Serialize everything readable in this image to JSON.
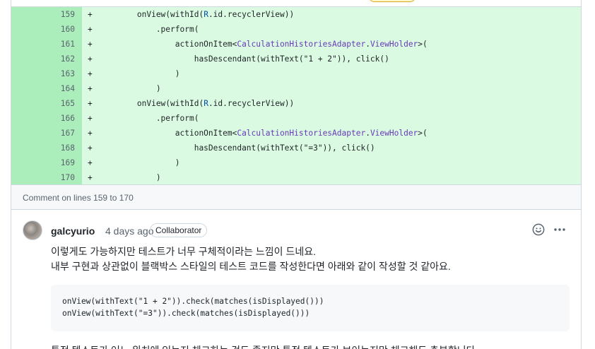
{
  "diff": {
    "rows": [
      {
        "line": "159",
        "marker": "+",
        "parts": [
          {
            "t": "        onView(withId(",
            "c": ""
          },
          {
            "t": "R",
            "c": "tk-r"
          },
          {
            "t": ".id.recyclerView))",
            "c": ""
          }
        ]
      },
      {
        "line": "160",
        "marker": "+",
        "parts": [
          {
            "t": "            .perform(",
            "c": ""
          }
        ]
      },
      {
        "line": "161",
        "marker": "+",
        "parts": [
          {
            "t": "                actionOnItem<",
            "c": ""
          },
          {
            "t": "CalculationHistoriesAdapter",
            "c": "tk-cls"
          },
          {
            "t": ".",
            "c": ""
          },
          {
            "t": "ViewHolder",
            "c": "tk-cls"
          },
          {
            "t": ">(",
            "c": ""
          }
        ]
      },
      {
        "line": "162",
        "marker": "+",
        "parts": [
          {
            "t": "                    hasDescendant(withText(\"1 + 2\")), click()",
            "c": ""
          }
        ]
      },
      {
        "line": "163",
        "marker": "+",
        "parts": [
          {
            "t": "                )",
            "c": ""
          }
        ]
      },
      {
        "line": "164",
        "marker": "+",
        "parts": [
          {
            "t": "            )",
            "c": ""
          }
        ]
      },
      {
        "line": "165",
        "marker": "+",
        "parts": [
          {
            "t": "        onView(withId(",
            "c": ""
          },
          {
            "t": "R",
            "c": "tk-r"
          },
          {
            "t": ".id.recyclerView))",
            "c": ""
          }
        ]
      },
      {
        "line": "166",
        "marker": "+",
        "parts": [
          {
            "t": "            .perform(",
            "c": ""
          }
        ]
      },
      {
        "line": "167",
        "marker": "+",
        "parts": [
          {
            "t": "                actionOnItem<",
            "c": ""
          },
          {
            "t": "CalculationHistoriesAdapter",
            "c": "tk-cls"
          },
          {
            "t": ".",
            "c": ""
          },
          {
            "t": "ViewHolder",
            "c": "tk-cls"
          },
          {
            "t": ">(",
            "c": ""
          }
        ]
      },
      {
        "line": "168",
        "marker": "+",
        "parts": [
          {
            "t": "                    hasDescendant(withText(\"=3\")), click()",
            "c": ""
          }
        ]
      },
      {
        "line": "169",
        "marker": "+",
        "parts": [
          {
            "t": "                )",
            "c": ""
          }
        ]
      },
      {
        "line": "170",
        "marker": "+",
        "parts": [
          {
            "t": "            )",
            "c": ""
          }
        ]
      }
    ]
  },
  "comment_meta": {
    "label": "Comment on lines 159 to 170"
  },
  "comment": {
    "author": "galcyurio",
    "time": "4 days ago",
    "badge": "Collaborator",
    "line1": "이렇게도 가능하지만 테스트가 너무 구체적이라는 느낌이 드네요.",
    "line2": "내부 구현과 상관없이 블랙박스 스타일의 테스트 코드를 작성한다면 아래와 같이 작성할 것 같아요.",
    "code_line1": "onView(withText(\"1 + 2\")).check(matches(isDisplayed()))",
    "code_line2": "onView(withText(\"=3\")).check(matches(isDisplayed()))",
    "line3": "특정 텍스트가 어느 위치에 있는지 체크하는 것도 좋지만 특정 텍스트가 보이는지만 체크해도 충분합니다"
  },
  "icons": {
    "reaction": "smiley-icon",
    "more": "kebab-horizontal-icon"
  }
}
